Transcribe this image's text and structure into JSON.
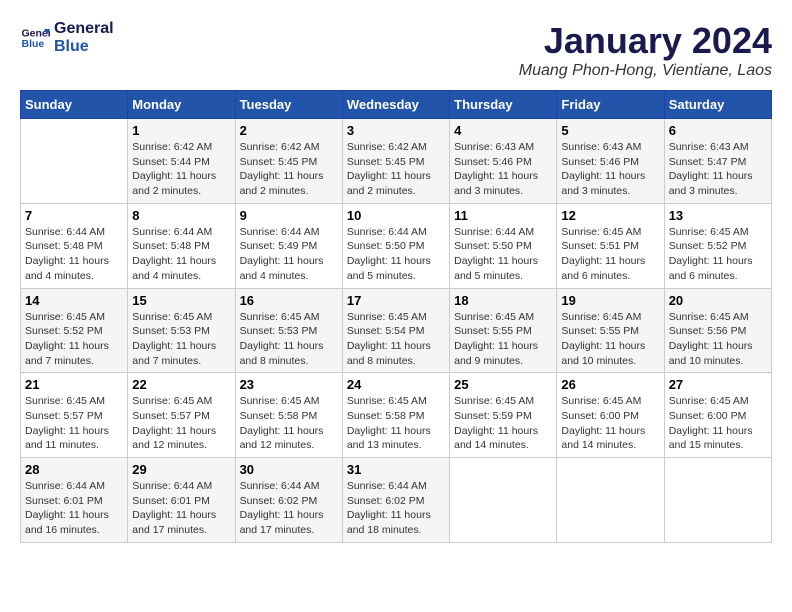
{
  "logo": {
    "line1": "General",
    "line2": "Blue"
  },
  "title": "January 2024",
  "subtitle": "Muang Phon-Hong, Vientiane, Laos",
  "headers": [
    "Sunday",
    "Monday",
    "Tuesday",
    "Wednesday",
    "Thursday",
    "Friday",
    "Saturday"
  ],
  "weeks": [
    [
      {
        "day": "",
        "info": ""
      },
      {
        "day": "1",
        "info": "Sunrise: 6:42 AM\nSunset: 5:44 PM\nDaylight: 11 hours\nand 2 minutes."
      },
      {
        "day": "2",
        "info": "Sunrise: 6:42 AM\nSunset: 5:45 PM\nDaylight: 11 hours\nand 2 minutes."
      },
      {
        "day": "3",
        "info": "Sunrise: 6:42 AM\nSunset: 5:45 PM\nDaylight: 11 hours\nand 2 minutes."
      },
      {
        "day": "4",
        "info": "Sunrise: 6:43 AM\nSunset: 5:46 PM\nDaylight: 11 hours\nand 3 minutes."
      },
      {
        "day": "5",
        "info": "Sunrise: 6:43 AM\nSunset: 5:46 PM\nDaylight: 11 hours\nand 3 minutes."
      },
      {
        "day": "6",
        "info": "Sunrise: 6:43 AM\nSunset: 5:47 PM\nDaylight: 11 hours\nand 3 minutes."
      }
    ],
    [
      {
        "day": "7",
        "info": "Sunrise: 6:44 AM\nSunset: 5:48 PM\nDaylight: 11 hours\nand 4 minutes."
      },
      {
        "day": "8",
        "info": "Sunrise: 6:44 AM\nSunset: 5:48 PM\nDaylight: 11 hours\nand 4 minutes."
      },
      {
        "day": "9",
        "info": "Sunrise: 6:44 AM\nSunset: 5:49 PM\nDaylight: 11 hours\nand 4 minutes."
      },
      {
        "day": "10",
        "info": "Sunrise: 6:44 AM\nSunset: 5:50 PM\nDaylight: 11 hours\nand 5 minutes."
      },
      {
        "day": "11",
        "info": "Sunrise: 6:44 AM\nSunset: 5:50 PM\nDaylight: 11 hours\nand 5 minutes."
      },
      {
        "day": "12",
        "info": "Sunrise: 6:45 AM\nSunset: 5:51 PM\nDaylight: 11 hours\nand 6 minutes."
      },
      {
        "day": "13",
        "info": "Sunrise: 6:45 AM\nSunset: 5:52 PM\nDaylight: 11 hours\nand 6 minutes."
      }
    ],
    [
      {
        "day": "14",
        "info": "Sunrise: 6:45 AM\nSunset: 5:52 PM\nDaylight: 11 hours\nand 7 minutes."
      },
      {
        "day": "15",
        "info": "Sunrise: 6:45 AM\nSunset: 5:53 PM\nDaylight: 11 hours\nand 7 minutes."
      },
      {
        "day": "16",
        "info": "Sunrise: 6:45 AM\nSunset: 5:53 PM\nDaylight: 11 hours\nand 8 minutes."
      },
      {
        "day": "17",
        "info": "Sunrise: 6:45 AM\nSunset: 5:54 PM\nDaylight: 11 hours\nand 8 minutes."
      },
      {
        "day": "18",
        "info": "Sunrise: 6:45 AM\nSunset: 5:55 PM\nDaylight: 11 hours\nand 9 minutes."
      },
      {
        "day": "19",
        "info": "Sunrise: 6:45 AM\nSunset: 5:55 PM\nDaylight: 11 hours\nand 10 minutes."
      },
      {
        "day": "20",
        "info": "Sunrise: 6:45 AM\nSunset: 5:56 PM\nDaylight: 11 hours\nand 10 minutes."
      }
    ],
    [
      {
        "day": "21",
        "info": "Sunrise: 6:45 AM\nSunset: 5:57 PM\nDaylight: 11 hours\nand 11 minutes."
      },
      {
        "day": "22",
        "info": "Sunrise: 6:45 AM\nSunset: 5:57 PM\nDaylight: 11 hours\nand 12 minutes."
      },
      {
        "day": "23",
        "info": "Sunrise: 6:45 AM\nSunset: 5:58 PM\nDaylight: 11 hours\nand 12 minutes."
      },
      {
        "day": "24",
        "info": "Sunrise: 6:45 AM\nSunset: 5:58 PM\nDaylight: 11 hours\nand 13 minutes."
      },
      {
        "day": "25",
        "info": "Sunrise: 6:45 AM\nSunset: 5:59 PM\nDaylight: 11 hours\nand 14 minutes."
      },
      {
        "day": "26",
        "info": "Sunrise: 6:45 AM\nSunset: 6:00 PM\nDaylight: 11 hours\nand 14 minutes."
      },
      {
        "day": "27",
        "info": "Sunrise: 6:45 AM\nSunset: 6:00 PM\nDaylight: 11 hours\nand 15 minutes."
      }
    ],
    [
      {
        "day": "28",
        "info": "Sunrise: 6:44 AM\nSunset: 6:01 PM\nDaylight: 11 hours\nand 16 minutes."
      },
      {
        "day": "29",
        "info": "Sunrise: 6:44 AM\nSunset: 6:01 PM\nDaylight: 11 hours\nand 17 minutes."
      },
      {
        "day": "30",
        "info": "Sunrise: 6:44 AM\nSunset: 6:02 PM\nDaylight: 11 hours\nand 17 minutes."
      },
      {
        "day": "31",
        "info": "Sunrise: 6:44 AM\nSunset: 6:02 PM\nDaylight: 11 hours\nand 18 minutes."
      },
      {
        "day": "",
        "info": ""
      },
      {
        "day": "",
        "info": ""
      },
      {
        "day": "",
        "info": ""
      }
    ]
  ]
}
